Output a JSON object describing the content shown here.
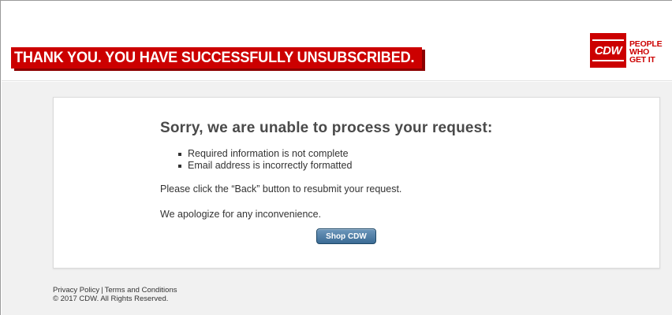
{
  "header": {
    "banner_text": "THANK YOU.  YOU HAVE SUCCESSFULLY UNSUBSCRIBED.",
    "logo": {
      "mark_text": "CDW",
      "tagline": [
        "PEOPLE",
        "WHO",
        "GET IT"
      ]
    }
  },
  "card": {
    "title": "Sorry, we are unable to process your request:",
    "reasons": [
      "Required information is not complete",
      "Email address is incorrectly formatted"
    ],
    "instruction": "Please click the “Back” button to resubmit your request.",
    "apology": "We apologize for any inconvenience.",
    "button_label": "Shop CDW"
  },
  "footer": {
    "privacy_link": "Privacy Policy",
    "separator": "|",
    "terms_link": "Terms and Conditions",
    "copyright": "© 2017 CDW. All Rights Reserved."
  },
  "colors": {
    "brand_red": "#cc0000",
    "button_blue": "#3b6b95",
    "page_background": "#f1f1f1"
  }
}
